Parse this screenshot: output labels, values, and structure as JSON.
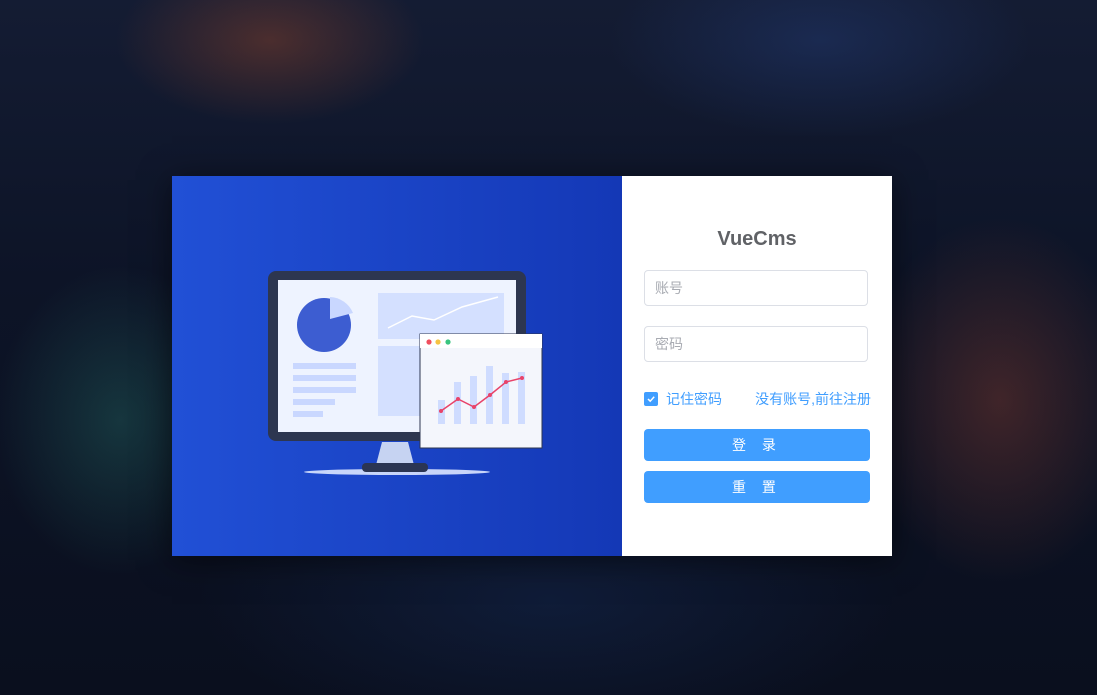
{
  "app": {
    "title": "VueCms"
  },
  "form": {
    "username_placeholder": "账号",
    "password_placeholder": "密码",
    "remember_label": "记住密码",
    "remember_checked": true,
    "register_link": "没有账号,前往注册",
    "login_label": "登 录",
    "reset_label": "重 置"
  },
  "colors": {
    "primary": "#409eff",
    "illustration_bg_start": "#2150d6",
    "illustration_bg_end": "#1438b6",
    "title": "#606266"
  },
  "icons": {
    "checkbox": "checkmark-icon",
    "illustration": "monitor-dashboard-illustration"
  }
}
